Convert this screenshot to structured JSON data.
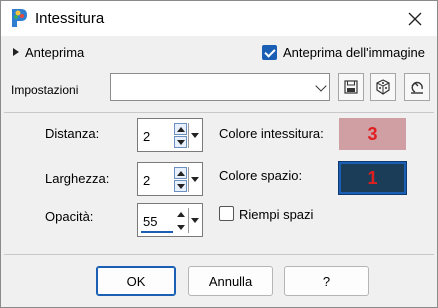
{
  "window": {
    "title": "Intessitura"
  },
  "preview": {
    "toggle_label": "Anteprima",
    "image_preview_label": "Anteprima dell'immagine",
    "image_preview_checked": true
  },
  "settings": {
    "label": "Impostazioni",
    "value": ""
  },
  "fields": {
    "distance": {
      "label": "Distanza:",
      "value": "2"
    },
    "width": {
      "label": "Larghezza:",
      "value": "2"
    },
    "opacity": {
      "label": "Opacità:",
      "value": "55"
    }
  },
  "colors": {
    "weave_label": "Colore intessitura:",
    "weave_color": "#cf9fa3",
    "weave_marker": "3",
    "space_label": "Colore spazio:",
    "space_color": "#1c3d58",
    "space_marker": "1",
    "marker_color": "#e02020"
  },
  "fill_spaces": {
    "label": "Riempi spazi",
    "checked": false
  },
  "buttons": {
    "ok": "OK",
    "cancel": "Annulla",
    "help": "?"
  }
}
